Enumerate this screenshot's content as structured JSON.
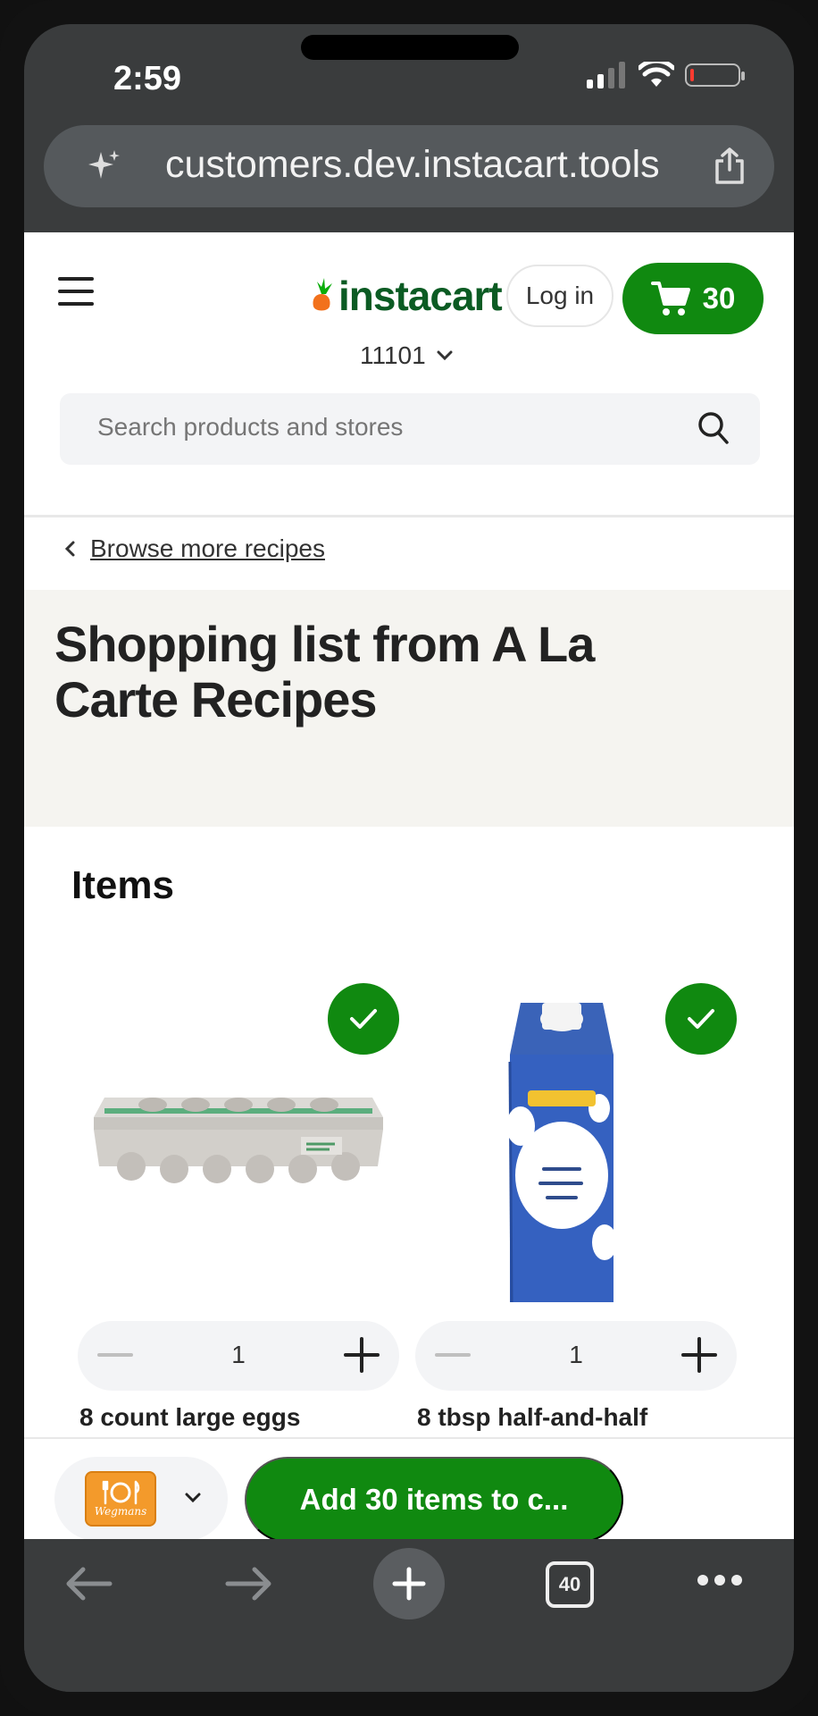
{
  "status_bar": {
    "time": "2:59"
  },
  "browser": {
    "url": "customers.dev.instacart.tools",
    "tab_count": "40"
  },
  "header": {
    "logo_text": "instacart",
    "login_label": "Log in",
    "cart_count": "30",
    "zip_code": "11101",
    "search_placeholder": "Search products and stores"
  },
  "breadcrumb": {
    "label": "Browse more recipes"
  },
  "hero": {
    "title": "Shopping list from A La Carte Recipes"
  },
  "items": {
    "heading": "Items",
    "list": [
      {
        "name": "8 count large eggs",
        "quantity": "1",
        "selected": true
      },
      {
        "name": "8 tbsp half-and-half",
        "quantity": "1",
        "selected": true
      }
    ]
  },
  "footer": {
    "store_logo_text": "Wegmans",
    "add_button_label": "Add 30 items to c..."
  },
  "colors": {
    "brand_green": "#108910",
    "logo_green": "#0b5b23",
    "logo_orange": "#f2711c"
  }
}
